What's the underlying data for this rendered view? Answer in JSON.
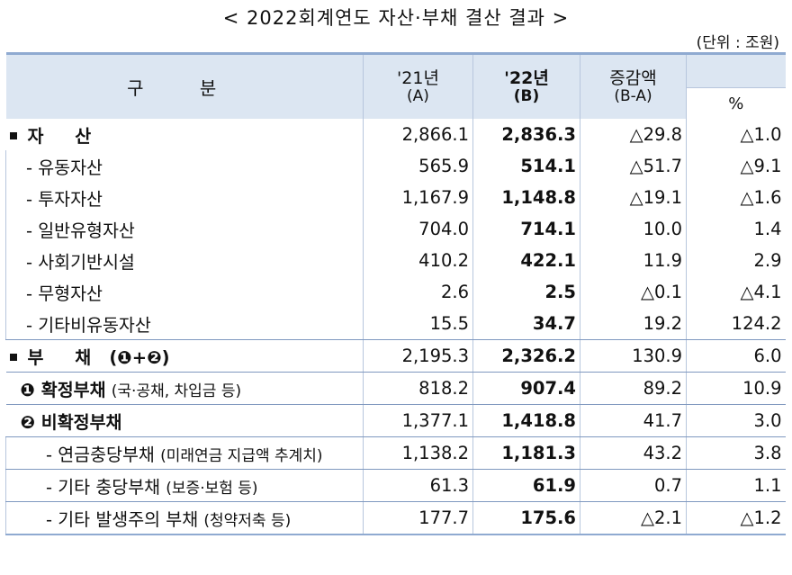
{
  "title": "< 2022회계연도 자산·부채 결산 결과 >",
  "unit": "(단위 : 조원)",
  "header": {
    "gubun": "구 분",
    "col21": {
      "main": "'21년",
      "sub": "(A)"
    },
    "col22": {
      "main": "'22년",
      "sub": "(B)"
    },
    "diff": {
      "main": "증감액",
      "sub": "(B-A)"
    },
    "pct": "%"
  },
  "rows": [
    {
      "label": "자 산",
      "a": "2,866.1",
      "b": "2,836.3",
      "diff": "△29.8",
      "pct": "△1.0"
    },
    {
      "label": "- 유동자산",
      "a": "565.9",
      "b": "514.1",
      "diff": "△51.7",
      "pct": "△9.1"
    },
    {
      "label": "- 투자자산",
      "a": "1,167.9",
      "b": "1,148.8",
      "diff": "△19.1",
      "pct": "△1.6"
    },
    {
      "label": "- 일반유형자산",
      "a": "704.0",
      "b": "714.1",
      "diff": "10.0",
      "pct": "1.4"
    },
    {
      "label": "- 사회기반시설",
      "a": "410.2",
      "b": "422.1",
      "diff": "11.9",
      "pct": "2.9"
    },
    {
      "label": "- 무형자산",
      "a": "2.6",
      "b": "2.5",
      "diff": "△0.1",
      "pct": "△4.1"
    },
    {
      "label": "- 기타비유동자산",
      "a": "15.5",
      "b": "34.7",
      "diff": "19.2",
      "pct": "124.2"
    },
    {
      "label": "부 채",
      "label_suffix": "(❶+❷)",
      "a": "2,195.3",
      "b": "2,326.2",
      "diff": "130.9",
      "pct": "6.0"
    },
    {
      "label": "❶ 확정부채",
      "note": "(국·공채, 차입금 등)",
      "a": "818.2",
      "b": "907.4",
      "diff": "89.2",
      "pct": "10.9"
    },
    {
      "label": "❷ 비확정부채",
      "a": "1,377.1",
      "b": "1,418.8",
      "diff": "41.7",
      "pct": "3.0"
    },
    {
      "label": "- 연금충당부채",
      "note": "(미래연금 지급액 추계치)",
      "a": "1,138.2",
      "b": "1,181.3",
      "diff": "43.2",
      "pct": "3.8"
    },
    {
      "label": "- 기타 충당부채",
      "note": "(보증·보험 등)",
      "a": "61.3",
      "b": "61.9",
      "diff": "0.7",
      "pct": "1.1"
    },
    {
      "label": "- 기타 발생주의 부채",
      "note": "(청약저축 등)",
      "a": "177.7",
      "b": "175.6",
      "diff": "△2.1",
      "pct": "△1.2"
    }
  ]
}
